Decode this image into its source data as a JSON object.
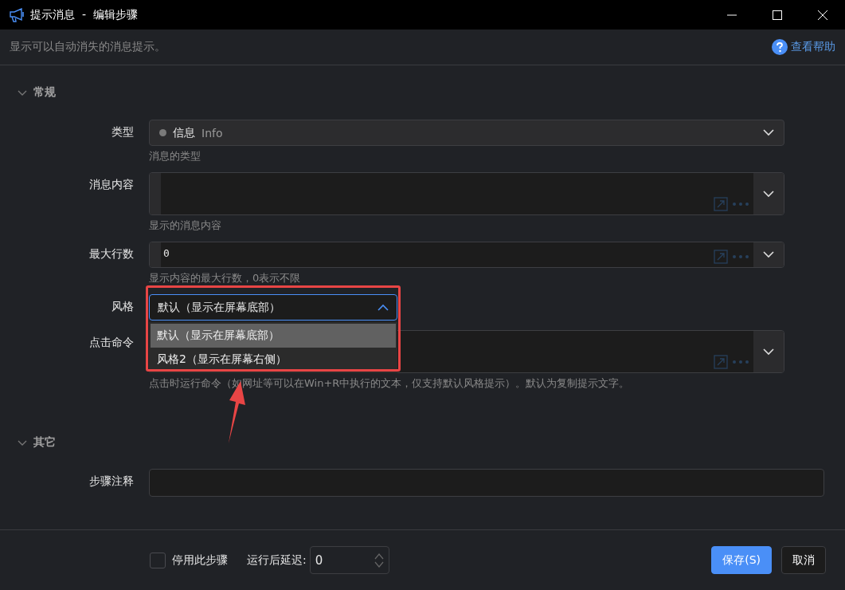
{
  "window": {
    "title": "提示消息  -  编辑步骤"
  },
  "description": "显示可以自动消失的消息提示。",
  "help_link": "查看帮助",
  "sections": [
    {
      "title": "常规",
      "expanded": true,
      "fields": [
        {
          "kind": "select",
          "label": "类型",
          "value": "信息",
          "secondary": "Info",
          "color": "#7a7a7a",
          "hint": "消息的类型"
        },
        {
          "kind": "editor",
          "label": "消息内容",
          "multiline": true,
          "hint": "显示的消息内容"
        },
        {
          "kind": "editor",
          "label": "最大行数",
          "value": "0",
          "multiline": false,
          "hint": "显示内容的最大行数，0表示不限"
        },
        {
          "kind": "dropdown",
          "label": "风格",
          "value": "默认（显示在屏幕底部）",
          "open": true,
          "options": [
            {
              "label": "默认（显示在屏幕底部）",
              "selected": true
            },
            {
              "label": "风格2（显示在屏幕右侧）",
              "selected": false
            }
          ]
        },
        {
          "kind": "editor",
          "label": "点击命令",
          "multiline": true,
          "hint": "点击时运行命令（如网址等可以在Win+R中执行的文本，仅支持默认风格提示）。默认为复制提示文字。"
        }
      ]
    },
    {
      "title": "其它",
      "expanded": true,
      "fields": [
        {
          "kind": "text",
          "label": "步骤注释"
        }
      ]
    }
  ],
  "footer": {
    "disable": {
      "label": "停用此步骤",
      "checked": false
    },
    "delay": {
      "label": "运行后延迟:",
      "value": "0"
    },
    "buttons": [
      {
        "label": "保存(S)",
        "primary": true
      },
      {
        "label": "取消",
        "primary": false
      }
    ]
  }
}
